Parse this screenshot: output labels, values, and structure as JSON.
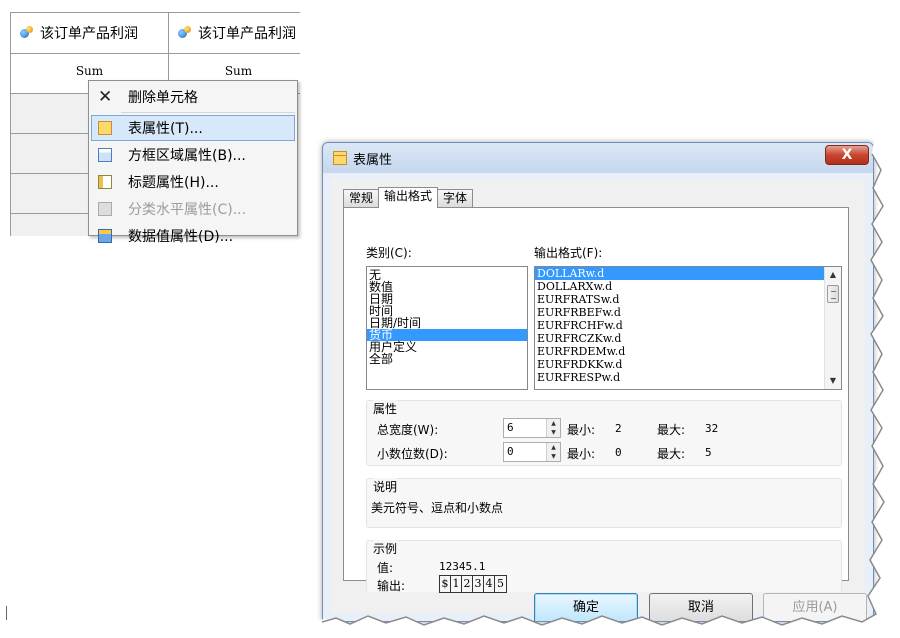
{
  "grid": {
    "headers": [
      "该订单产品利润",
      "该订单产品利润"
    ],
    "sum_labels": [
      "Sum",
      "Sum"
    ]
  },
  "context_menu": {
    "items": [
      {
        "label": "删除单元格",
        "icon": "delete-x-icon",
        "state": "normal"
      },
      {
        "label": "表属性(T)...",
        "icon": "table-properties-icon",
        "state": "selected"
      },
      {
        "label": "方框区域属性(B)...",
        "icon": "box-area-icon",
        "state": "normal"
      },
      {
        "label": "标题属性(H)...",
        "icon": "heading-icon",
        "state": "normal"
      },
      {
        "label": "分类水平属性(C)...",
        "icon": "class-level-icon",
        "state": "disabled"
      },
      {
        "label": "数据值属性(D)...",
        "icon": "data-value-icon",
        "state": "normal"
      }
    ]
  },
  "dialog": {
    "title": "表属性",
    "close_glyph": "X",
    "tabs": [
      "常规",
      "输出格式",
      "字体"
    ],
    "active_tab": "输出格式",
    "category_label": "类别(C):",
    "categories": [
      "无",
      "数值",
      "日期",
      "时间",
      "日期/时间",
      "货币",
      "用户定义",
      "全部"
    ],
    "selected_category": "货币",
    "format_label": "输出格式(F):",
    "formats": [
      "DOLLARw.d",
      "DOLLARXw.d",
      "EURFRATSw.d",
      "EURFRBEFw.d",
      "EURFRCHFw.d",
      "EURFRCZKw.d",
      "EURFRDEMw.d",
      "EURFRDKKw.d",
      "EURFRESPw.d"
    ],
    "selected_format": "DOLLARw.d",
    "properties": {
      "title": "属性",
      "width_label": "总宽度(W):",
      "width_value": "6",
      "width_min_label": "最小:",
      "width_min": "2",
      "width_max_label": "最大:",
      "width_max": "32",
      "decimals_label": "小数位数(D):",
      "decimals_value": "0",
      "decimals_min_label": "最小:",
      "decimals_min": "0",
      "decimals_max_label": "最大:",
      "decimals_max": "5"
    },
    "description": {
      "title": "说明",
      "text": "美元符号、逗点和小数点"
    },
    "example": {
      "title": "示例",
      "value_label": "值:",
      "value": "12345.1",
      "output_label": "输出:",
      "output_chars": [
        "$",
        "1",
        "2",
        "3",
        "4",
        "5"
      ]
    },
    "buttons": {
      "ok": "确定",
      "cancel": "取消",
      "apply": "应用(A)"
    }
  }
}
